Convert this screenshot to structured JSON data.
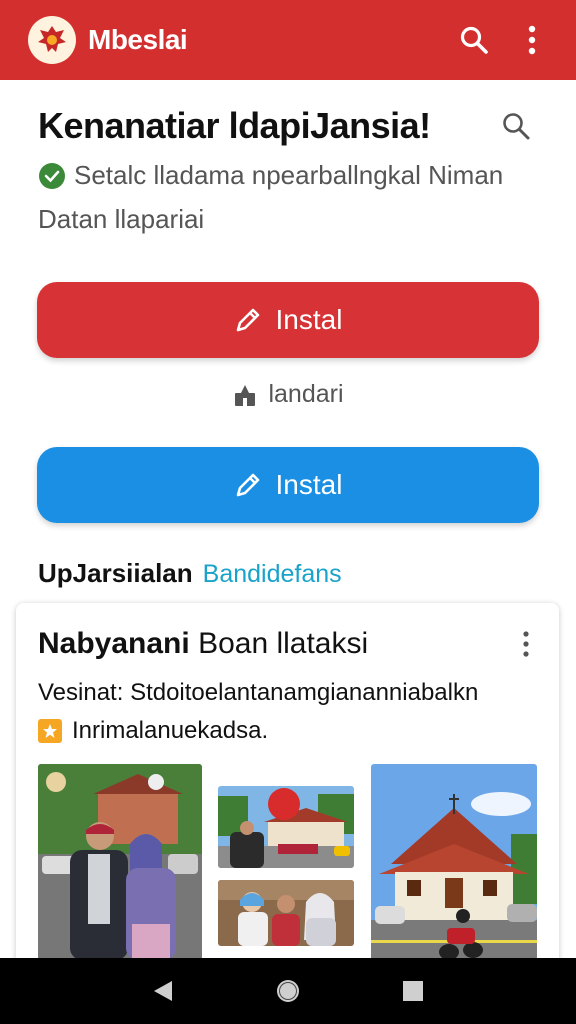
{
  "app_bar": {
    "title": "Mbeslai",
    "logo_icon": "garuda-emblem-icon",
    "background": "#d32f2f"
  },
  "header": {
    "title": "Kenanatiar ldapiJansia!",
    "subtitle": "Setalc lladama npearballngkal Niman",
    "subtitle_line2": "Datan llapariai"
  },
  "buttons": {
    "primary_label": "Instal",
    "primary_color": "#d73235",
    "secondary_label": "Instal",
    "secondary_color": "#1a8fe3",
    "middle_link": "landari"
  },
  "section": {
    "title": "UpJarsiialan",
    "link": "Bandidefans"
  },
  "card": {
    "title_bold": "Nabyanani",
    "title_rest": "Boan llataksi",
    "description": "Vesinat: Stdoitoelantanamgiananniabalkn",
    "note": "Inrimalanuekadsa.",
    "photos": [
      {
        "name": "couple-photo"
      },
      {
        "name": "ceremony-photo"
      },
      {
        "name": "family-photo"
      },
      {
        "name": "building-photo"
      }
    ]
  },
  "nav": {
    "back": "back-icon",
    "home": "home-icon",
    "recents": "recents-icon"
  }
}
